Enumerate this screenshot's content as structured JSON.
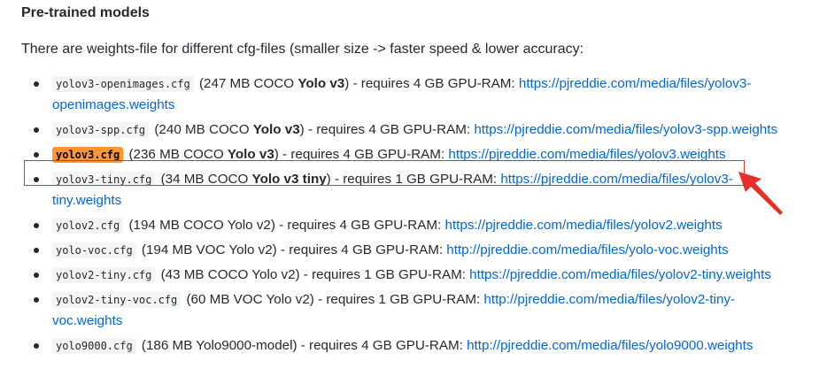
{
  "section": {
    "heading": "Pre-trained models",
    "intro": "There are weights-file for different cfg-files (smaller size -> faster speed & lower accuracy:"
  },
  "models": [
    {
      "cfg": "yolov3-openimages.cfg",
      "pre": " (247 MB COCO ",
      "bold": "Yolo v3",
      "post": ") - requires 4 GB GPU-RAM: ",
      "url": "https://pjreddie.com/media/files/yolov3-openimages.weights"
    },
    {
      "cfg": "yolov3-spp.cfg",
      "pre": " (240 MB COCO ",
      "bold": "Yolo v3",
      "post": ") - requires 4 GB GPU-RAM: ",
      "url": "https://pjreddie.com/media/files/yolov3-spp.weights"
    },
    {
      "cfg": "yolov3.cfg",
      "pre": " (236 MB COCO ",
      "bold": "Yolo v3",
      "post": ") - requires 4 GB GPU-RAM: ",
      "url": "https://pjreddie.com/media/files/yolov3.weights"
    },
    {
      "cfg": "yolov3-tiny.cfg",
      "pre": " (34 MB COCO ",
      "bold": "Yolo v3 tiny",
      "post": ") - requires 1 GB GPU-RAM: ",
      "url": "https://pjreddie.com/media/files/yolov3-tiny.weights"
    },
    {
      "cfg": "yolov2.cfg",
      "pre": " (194 MB COCO Yolo v2) - requires 4 GB GPU-RAM: ",
      "bold": "",
      "post": "",
      "url": "https://pjreddie.com/media/files/yolov2.weights"
    },
    {
      "cfg": "yolo-voc.cfg",
      "pre": " (194 MB VOC Yolo v2) - requires 4 GB GPU-RAM: ",
      "bold": "",
      "post": "",
      "url": "http://pjreddie.com/media/files/yolo-voc.weights"
    },
    {
      "cfg": "yolov2-tiny.cfg",
      "pre": " (43 MB COCO Yolo v2) - requires 1 GB GPU-RAM: ",
      "bold": "",
      "post": "",
      "url": "https://pjreddie.com/media/files/yolov2-tiny.weights"
    },
    {
      "cfg": "yolov2-tiny-voc.cfg",
      "pre": " (60 MB VOC Yolo v2) - requires 1 GB GPU-RAM: ",
      "bold": "",
      "post": "",
      "url": "http://pjreddie.com/media/files/yolov2-tiny-voc.weights"
    },
    {
      "cfg": "yolo9000.cfg",
      "pre": " (186 MB Yolo9000-model) - requires 4 GB GPU-RAM: ",
      "bold": "",
      "post": "",
      "url": "http://pjreddie.com/media/files/yolo9000.weights"
    }
  ],
  "annotation": {
    "highlight_color": "#ff9632",
    "box_color": "#e5302a"
  }
}
